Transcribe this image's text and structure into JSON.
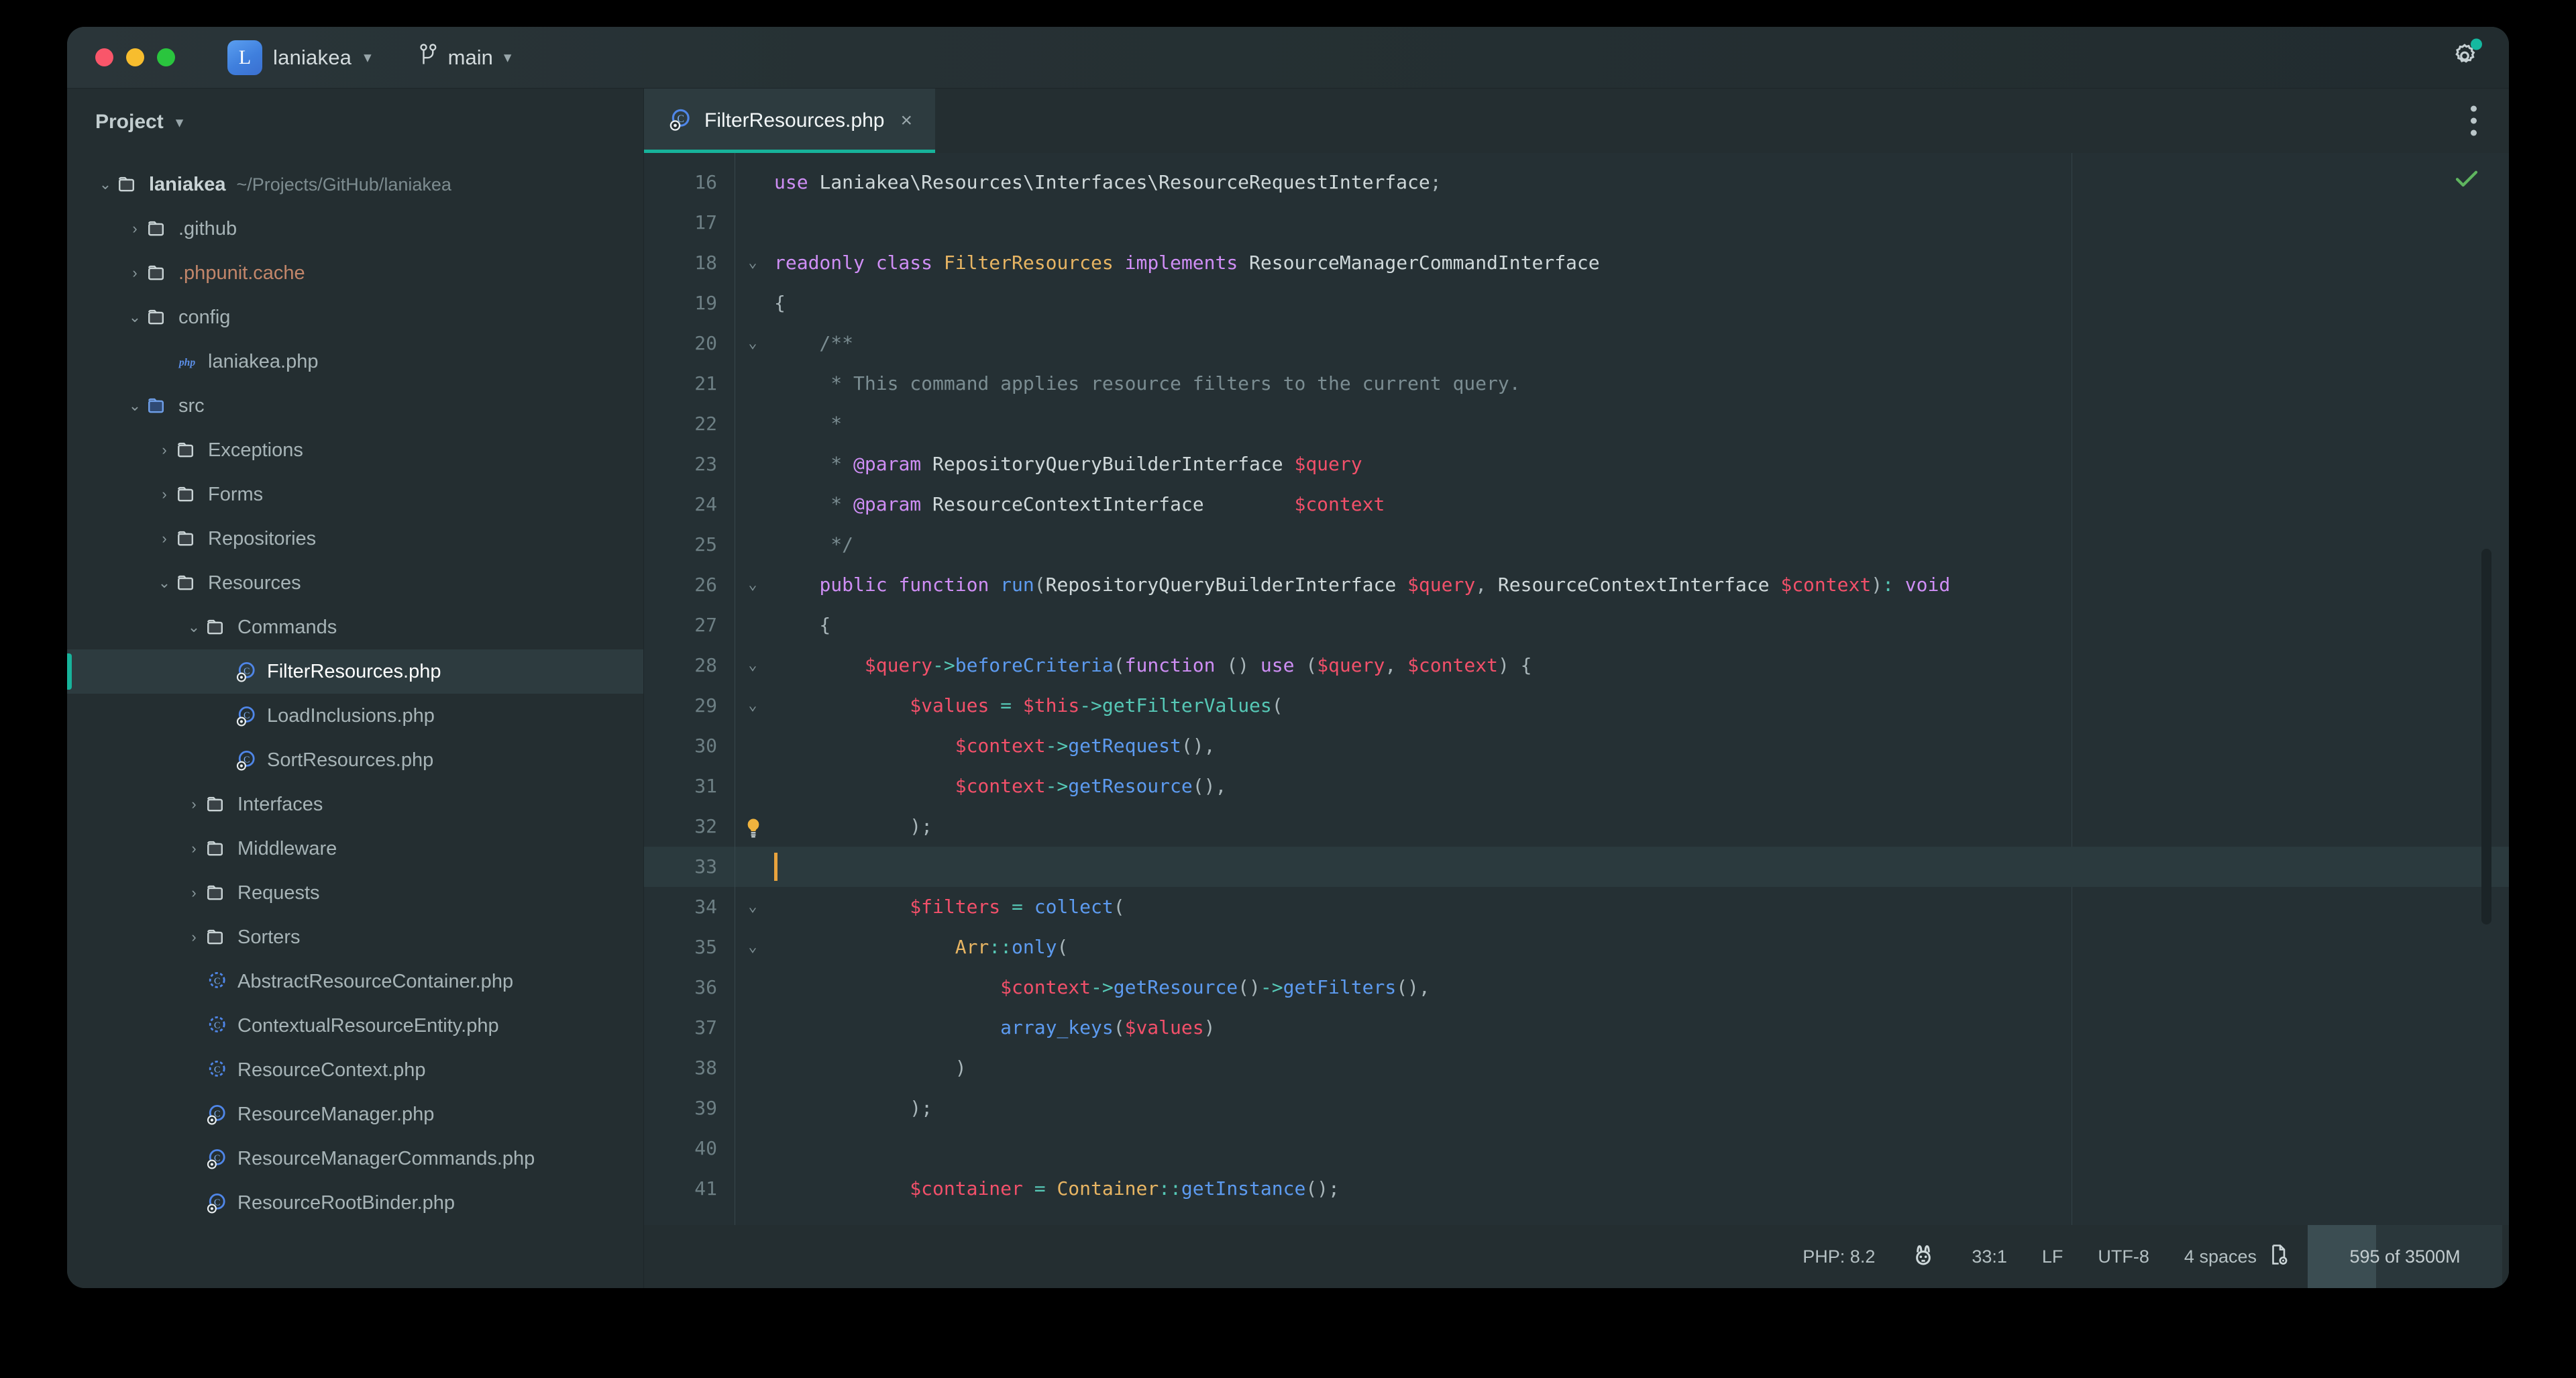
{
  "titlebar": {
    "project_badge_letter": "L",
    "project_name": "laniakea",
    "branch_name": "main",
    "settings_icon": "gear-icon",
    "branch_icon": "git-branch-icon"
  },
  "sidebar": {
    "header_label": "Project",
    "tree": [
      {
        "indent": 0,
        "arrow": "down",
        "icon": "folder-icon",
        "label": "laniakea",
        "path": "~/Projects/GitHub/laniakea",
        "style": "strong",
        "selected": false
      },
      {
        "indent": 1,
        "arrow": "right",
        "icon": "folder-icon",
        "label": ".github",
        "path": "",
        "style": "",
        "selected": false
      },
      {
        "indent": 1,
        "arrow": "right",
        "icon": "folder-icon",
        "label": ".phpunit.cache",
        "path": "",
        "style": "orange",
        "selected": false
      },
      {
        "indent": 1,
        "arrow": "down",
        "icon": "folder-icon",
        "label": "config",
        "path": "",
        "style": "",
        "selected": false
      },
      {
        "indent": 2,
        "arrow": "none",
        "icon": "php-file-icon",
        "label": "laniakea.php",
        "path": "",
        "style": "",
        "selected": false
      },
      {
        "indent": 1,
        "arrow": "down",
        "icon": "folder-source-icon",
        "label": "src",
        "path": "",
        "style": "",
        "selected": false
      },
      {
        "indent": 2,
        "arrow": "right",
        "icon": "folder-icon",
        "label": "Exceptions",
        "path": "",
        "style": "",
        "selected": false
      },
      {
        "indent": 2,
        "arrow": "right",
        "icon": "folder-icon",
        "label": "Forms",
        "path": "",
        "style": "",
        "selected": false
      },
      {
        "indent": 2,
        "arrow": "right",
        "icon": "folder-icon",
        "label": "Repositories",
        "path": "",
        "style": "",
        "selected": false
      },
      {
        "indent": 2,
        "arrow": "down",
        "icon": "folder-icon",
        "label": "Resources",
        "path": "",
        "style": "",
        "selected": false
      },
      {
        "indent": 3,
        "arrow": "down",
        "icon": "folder-icon",
        "label": "Commands",
        "path": "",
        "style": "",
        "selected": false
      },
      {
        "indent": 4,
        "arrow": "none",
        "icon": "php-class-public-icon",
        "label": "FilterResources.php",
        "path": "",
        "style": "",
        "selected": true
      },
      {
        "indent": 4,
        "arrow": "none",
        "icon": "php-class-public-icon",
        "label": "LoadInclusions.php",
        "path": "",
        "style": "",
        "selected": false
      },
      {
        "indent": 4,
        "arrow": "none",
        "icon": "php-class-public-icon",
        "label": "SortResources.php",
        "path": "",
        "style": "",
        "selected": false
      },
      {
        "indent": 3,
        "arrow": "right",
        "icon": "folder-icon",
        "label": "Interfaces",
        "path": "",
        "style": "",
        "selected": false
      },
      {
        "indent": 3,
        "arrow": "right",
        "icon": "folder-icon",
        "label": "Middleware",
        "path": "",
        "style": "",
        "selected": false
      },
      {
        "indent": 3,
        "arrow": "right",
        "icon": "folder-icon",
        "label": "Requests",
        "path": "",
        "style": "",
        "selected": false
      },
      {
        "indent": 3,
        "arrow": "right",
        "icon": "folder-icon",
        "label": "Sorters",
        "path": "",
        "style": "",
        "selected": false
      },
      {
        "indent": 3,
        "arrow": "none",
        "icon": "php-class-abstract-icon",
        "label": "AbstractResourceContainer.php",
        "path": "",
        "style": "",
        "selected": false
      },
      {
        "indent": 3,
        "arrow": "none",
        "icon": "php-class-abstract-icon",
        "label": "ContextualResourceEntity.php",
        "path": "",
        "style": "",
        "selected": false
      },
      {
        "indent": 3,
        "arrow": "none",
        "icon": "php-class-abstract-icon",
        "label": "ResourceContext.php",
        "path": "",
        "style": "",
        "selected": false
      },
      {
        "indent": 3,
        "arrow": "none",
        "icon": "php-class-public-icon",
        "label": "ResourceManager.php",
        "path": "",
        "style": "",
        "selected": false
      },
      {
        "indent": 3,
        "arrow": "none",
        "icon": "php-class-public-icon",
        "label": "ResourceManagerCommands.php",
        "path": "",
        "style": "",
        "selected": false
      },
      {
        "indent": 3,
        "arrow": "none",
        "icon": "php-class-public-icon",
        "label": "ResourceRootBinder.php",
        "path": "",
        "style": "",
        "selected": false
      }
    ]
  },
  "editor": {
    "tab": {
      "label": "FilterResources.php",
      "icon": "php-class-public-icon",
      "close_label": "×"
    },
    "kebab_label": "more-options",
    "inspection_status_icon": "check-ok-icon",
    "first_line_number": 16,
    "lines": [
      {
        "n": 16,
        "fold": "",
        "active": false,
        "tokens": [
          {
            "t": "use ",
            "c": "kw"
          },
          {
            "t": "Laniakea\\Resources\\Interfaces\\ResourceRequestInterface",
            "c": "id"
          },
          {
            "t": ";",
            "c": "pun"
          }
        ]
      },
      {
        "n": 17,
        "fold": "",
        "active": false,
        "tokens": []
      },
      {
        "n": 18,
        "fold": "down",
        "active": false,
        "tokens": [
          {
            "t": "readonly class ",
            "c": "kw"
          },
          {
            "t": "FilterResources",
            "c": "cls"
          },
          {
            "t": " implements ",
            "c": "kw"
          },
          {
            "t": "ResourceManagerCommandInterface",
            "c": "id"
          }
        ]
      },
      {
        "n": 19,
        "fold": "",
        "active": false,
        "tokens": [
          {
            "t": "{",
            "c": "pun"
          }
        ]
      },
      {
        "n": 20,
        "fold": "down",
        "active": false,
        "tokens": [
          {
            "t": "    /**",
            "c": "cmt"
          }
        ]
      },
      {
        "n": 21,
        "fold": "",
        "active": false,
        "tokens": [
          {
            "t": "     * This command applies resource filters to the current query.",
            "c": "cmt"
          }
        ]
      },
      {
        "n": 22,
        "fold": "",
        "active": false,
        "tokens": [
          {
            "t": "     *",
            "c": "cmt"
          }
        ]
      },
      {
        "n": 23,
        "fold": "",
        "active": false,
        "tokens": [
          {
            "t": "     * ",
            "c": "cmt"
          },
          {
            "t": "@param",
            "c": "tag"
          },
          {
            "t": " RepositoryQueryBuilderInterface ",
            "c": "id"
          },
          {
            "t": "$query",
            "c": "var"
          }
        ]
      },
      {
        "n": 24,
        "fold": "",
        "active": false,
        "tokens": [
          {
            "t": "     * ",
            "c": "cmt"
          },
          {
            "t": "@param",
            "c": "tag"
          },
          {
            "t": " ResourceContextInterface        ",
            "c": "id"
          },
          {
            "t": "$context",
            "c": "var"
          }
        ]
      },
      {
        "n": 25,
        "fold": "",
        "active": false,
        "tokens": [
          {
            "t": "     */",
            "c": "cmt"
          }
        ]
      },
      {
        "n": 26,
        "fold": "down",
        "active": false,
        "impl": true,
        "tokens": [
          {
            "t": "    ",
            "c": "id"
          },
          {
            "t": "public function ",
            "c": "kw"
          },
          {
            "t": "run",
            "c": "fn"
          },
          {
            "t": "(",
            "c": "pun"
          },
          {
            "t": "RepositoryQueryBuilderInterface ",
            "c": "id"
          },
          {
            "t": "$query",
            "c": "var"
          },
          {
            "t": ", ",
            "c": "pun"
          },
          {
            "t": "ResourceContextInterface ",
            "c": "id"
          },
          {
            "t": "$context",
            "c": "var"
          },
          {
            "t": ")",
            "c": "pun"
          },
          {
            "t": ":",
            "c": "op"
          },
          {
            "t": " ",
            "c": "id"
          },
          {
            "t": "void",
            "c": "kw"
          }
        ]
      },
      {
        "n": 27,
        "fold": "",
        "active": false,
        "tokens": [
          {
            "t": "    {",
            "c": "pun"
          }
        ]
      },
      {
        "n": 28,
        "fold": "down",
        "active": false,
        "tokens": [
          {
            "t": "        ",
            "c": "id"
          },
          {
            "t": "$query",
            "c": "var"
          },
          {
            "t": "->",
            "c": "op"
          },
          {
            "t": "beforeCriteria",
            "c": "fn"
          },
          {
            "t": "(",
            "c": "pun"
          },
          {
            "t": "function ",
            "c": "kw"
          },
          {
            "t": "()",
            "c": "pun"
          },
          {
            "t": " ",
            "c": "id"
          },
          {
            "t": "use ",
            "c": "kw"
          },
          {
            "t": "(",
            "c": "pun"
          },
          {
            "t": "$query",
            "c": "var"
          },
          {
            "t": ", ",
            "c": "pun"
          },
          {
            "t": "$context",
            "c": "var"
          },
          {
            "t": ")",
            "c": "pun"
          },
          {
            "t": " {",
            "c": "pun"
          }
        ]
      },
      {
        "n": 29,
        "fold": "down",
        "active": false,
        "tokens": [
          {
            "t": "            ",
            "c": "id"
          },
          {
            "t": "$values",
            "c": "var"
          },
          {
            "t": " = ",
            "c": "op"
          },
          {
            "t": "$this",
            "c": "var"
          },
          {
            "t": "->",
            "c": "op"
          },
          {
            "t": "getFilterValues",
            "c": "mth"
          },
          {
            "t": "(",
            "c": "pun"
          }
        ]
      },
      {
        "n": 30,
        "fold": "",
        "active": false,
        "tokens": [
          {
            "t": "                ",
            "c": "id"
          },
          {
            "t": "$context",
            "c": "var"
          },
          {
            "t": "->",
            "c": "op"
          },
          {
            "t": "getRequest",
            "c": "fn"
          },
          {
            "t": "(),",
            "c": "pun"
          }
        ]
      },
      {
        "n": 31,
        "fold": "",
        "active": false,
        "tokens": [
          {
            "t": "                ",
            "c": "id"
          },
          {
            "t": "$context",
            "c": "var"
          },
          {
            "t": "->",
            "c": "op"
          },
          {
            "t": "getResource",
            "c": "fn"
          },
          {
            "t": "(),",
            "c": "pun"
          }
        ]
      },
      {
        "n": 32,
        "fold": "",
        "active": false,
        "bulb": true,
        "tokens": [
          {
            "t": "            );",
            "c": "pun"
          }
        ]
      },
      {
        "n": 33,
        "fold": "",
        "active": true,
        "caret": true,
        "tokens": []
      },
      {
        "n": 34,
        "fold": "down",
        "active": false,
        "tokens": [
          {
            "t": "            ",
            "c": "id"
          },
          {
            "t": "$filters",
            "c": "var"
          },
          {
            "t": " = ",
            "c": "op"
          },
          {
            "t": "collect",
            "c": "fn"
          },
          {
            "t": "(",
            "c": "pun"
          }
        ]
      },
      {
        "n": 35,
        "fold": "down",
        "active": false,
        "tokens": [
          {
            "t": "                ",
            "c": "id"
          },
          {
            "t": "Arr",
            "c": "cls"
          },
          {
            "t": "::",
            "c": "op"
          },
          {
            "t": "only",
            "c": "fn"
          },
          {
            "t": "(",
            "c": "pun"
          }
        ]
      },
      {
        "n": 36,
        "fold": "",
        "active": false,
        "tokens": [
          {
            "t": "                    ",
            "c": "id"
          },
          {
            "t": "$context",
            "c": "var"
          },
          {
            "t": "->",
            "c": "op"
          },
          {
            "t": "getResource",
            "c": "fn"
          },
          {
            "t": "()",
            "c": "pun"
          },
          {
            "t": "->",
            "c": "op"
          },
          {
            "t": "getFilters",
            "c": "fn"
          },
          {
            "t": "(),",
            "c": "pun"
          }
        ]
      },
      {
        "n": 37,
        "fold": "",
        "active": false,
        "tokens": [
          {
            "t": "                    ",
            "c": "id"
          },
          {
            "t": "array_keys",
            "c": "fn"
          },
          {
            "t": "(",
            "c": "pun"
          },
          {
            "t": "$values",
            "c": "var"
          },
          {
            "t": ")",
            "c": "pun"
          }
        ]
      },
      {
        "n": 38,
        "fold": "",
        "active": false,
        "tokens": [
          {
            "t": "                )",
            "c": "pun"
          }
        ]
      },
      {
        "n": 39,
        "fold": "",
        "active": false,
        "tokens": [
          {
            "t": "            );",
            "c": "pun"
          }
        ]
      },
      {
        "n": 40,
        "fold": "",
        "active": false,
        "tokens": []
      },
      {
        "n": 41,
        "fold": "",
        "active": false,
        "tokens": [
          {
            "t": "            ",
            "c": "id"
          },
          {
            "t": "$container",
            "c": "var"
          },
          {
            "t": " = ",
            "c": "op"
          },
          {
            "t": "Container",
            "c": "cls"
          },
          {
            "t": "::",
            "c": "op"
          },
          {
            "t": "getInstance",
            "c": "fn"
          },
          {
            "t": "();",
            "c": "pun"
          }
        ]
      }
    ]
  },
  "statusbar": {
    "php_version": "PHP: 8.2",
    "framework_icon": "laravel-bunny-icon",
    "caret_position": "33:1",
    "line_separator": "LF",
    "encoding": "UTF-8",
    "indent": "4 spaces",
    "indent_icon": "file-settings-icon",
    "memory": "595 of 3500M",
    "memory_fill_percent": 35
  },
  "colors": {
    "accent_teal": "#17b39b",
    "window_bg": "#242e31",
    "editor_bg": "#253034",
    "caret": "#e8a33d"
  }
}
